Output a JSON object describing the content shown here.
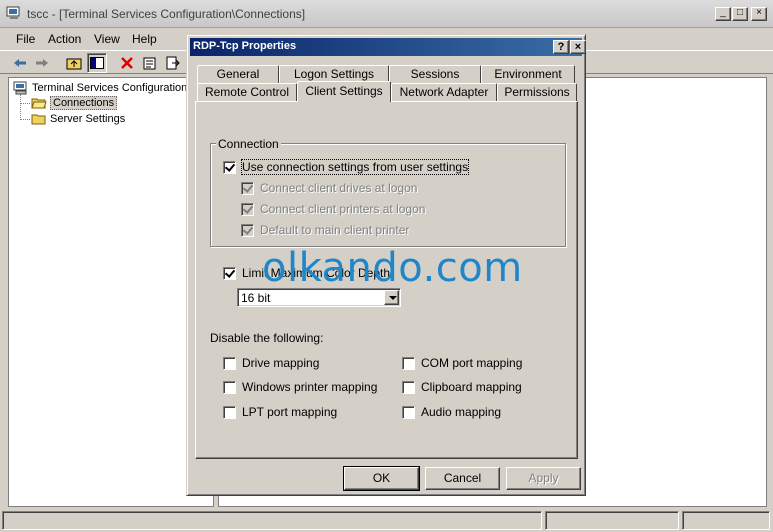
{
  "main_window": {
    "title": "tscc - [Terminal Services Configuration\\Connections]",
    "controls": {
      "minimize": "_",
      "maximize": "□",
      "close": "×"
    }
  },
  "menu": [
    "File",
    "Action",
    "View",
    "Help"
  ],
  "toolbar_icons": [
    "back-arrow-icon",
    "forward-arrow-icon",
    "up-folder-icon",
    "show-tree-icon",
    "delete-icon",
    "properties-icon",
    "export-icon"
  ],
  "tree": {
    "root": "Terminal Services Configuration",
    "children": [
      "Connections",
      "Server Settings"
    ],
    "selected": "Connections"
  },
  "dialog": {
    "title": "RDP-Tcp Properties",
    "help_btn": "?",
    "close_btn": "×",
    "tabs_row1": [
      "General",
      "Logon Settings",
      "Sessions",
      "Environment"
    ],
    "tabs_row2": [
      "Remote Control",
      "Client Settings",
      "Network Adapter",
      "Permissions"
    ],
    "active_tab": "Client Settings",
    "connection": {
      "label": "Connection",
      "use_user_settings": {
        "label": "Use connection settings from user settings",
        "checked": true
      },
      "sub_options": [
        {
          "label": "Connect client drives at logon",
          "checked": true,
          "enabled": false
        },
        {
          "label": "Connect client printers at logon",
          "checked": true,
          "enabled": false
        },
        {
          "label": "Default to main client printer",
          "checked": true,
          "enabled": false
        }
      ]
    },
    "limit_color": {
      "label": "Limit Maximum Color Depth",
      "checked": true,
      "value": "16 bit"
    },
    "disable": {
      "label": "Disable the following:",
      "left": [
        {
          "label": "Drive mapping",
          "checked": false
        },
        {
          "label": "Windows printer mapping",
          "checked": false
        },
        {
          "label": "LPT port mapping",
          "checked": false
        }
      ],
      "right": [
        {
          "label": "COM port mapping",
          "checked": false
        },
        {
          "label": "Clipboard mapping",
          "checked": false
        },
        {
          "label": "Audio mapping",
          "checked": false
        }
      ]
    },
    "buttons": {
      "ok": "OK",
      "cancel": "Cancel",
      "apply": "Apply"
    }
  },
  "watermark": "olkando.com"
}
